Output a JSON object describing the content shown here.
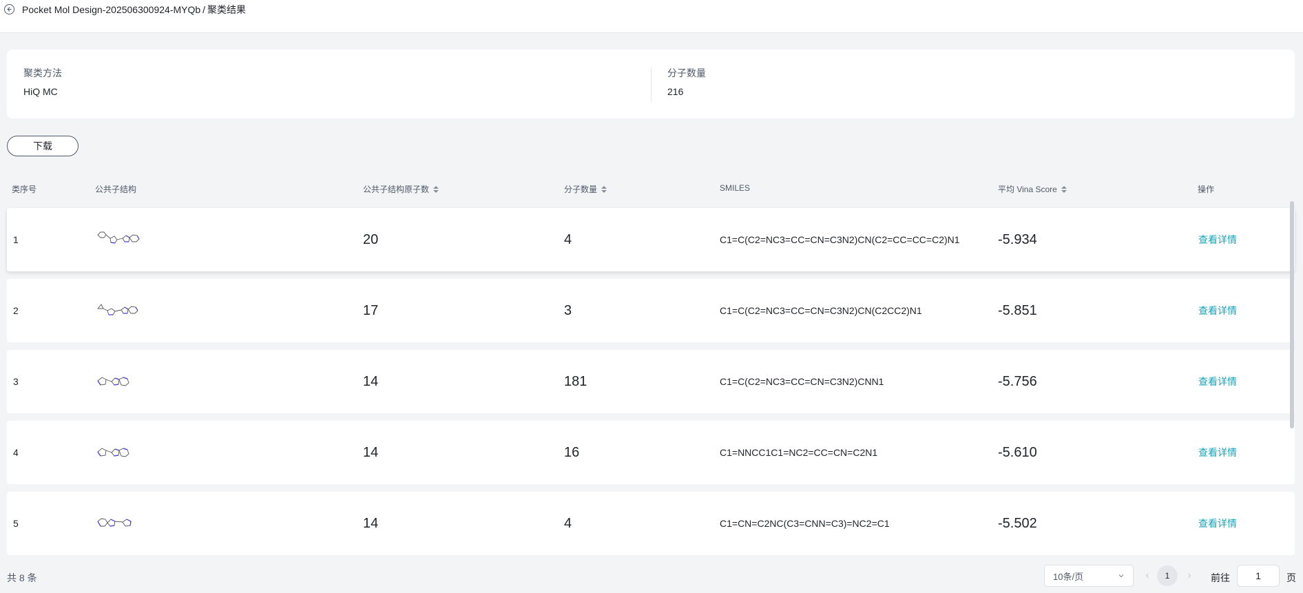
{
  "header": {
    "project": "Pocket Mol Design-202506300924-MYQb",
    "separator": "/",
    "page": "聚类结果"
  },
  "summary": {
    "method_label": "聚类方法",
    "method_value": "HiQ MC",
    "count_label": "分子数量",
    "count_value": "216"
  },
  "toolbar": {
    "download_label": "下载"
  },
  "table": {
    "columns": {
      "index": "类序号",
      "structure": "公共子结构",
      "atoms": "公共子结构原子数",
      "count": "分子数量",
      "smiles": "SMILES",
      "score": "平均 Vina Score",
      "action": "操作"
    },
    "rows": [
      {
        "index": "1",
        "atoms": "20",
        "count": "4",
        "smiles": "C1=C(C2=NC3=CC=CN=C3N2)CN(C2=CC=CC=C2)N1",
        "score": "-5.934",
        "action": "查看详情",
        "structure_icon": "phenyl-pyrazoline-imidazopyridine-structure-icon"
      },
      {
        "index": "2",
        "atoms": "17",
        "count": "3",
        "smiles": "C1=C(C2=NC3=CC=CN=C3N2)CN(C2CC2)N1",
        "score": "-5.851",
        "action": "查看详情",
        "structure_icon": "cyclopropyl-pyrazoline-imidazopyridine-structure-icon"
      },
      {
        "index": "3",
        "atoms": "14",
        "count": "181",
        "smiles": "C1=C(C2=NC3=CC=CN=C3N2)CNN1",
        "score": "-5.756",
        "action": "查看详情",
        "structure_icon": "pyrazoline-imidazopyridine-structure-icon"
      },
      {
        "index": "4",
        "atoms": "14",
        "count": "16",
        "smiles": "C1=NNCC1C1=NC2=CC=CN=C2N1",
        "score": "-5.610",
        "action": "查看详情",
        "structure_icon": "pyrazoline-imidazopyridine-structure-icon"
      },
      {
        "index": "5",
        "atoms": "14",
        "count": "4",
        "smiles": "C1=CN=C2NC(C3=CNN=C3)=NC2=C1",
        "score": "-5.502",
        "action": "查看详情",
        "structure_icon": "pyrazole-imidazopyridine-structure-icon"
      }
    ]
  },
  "footer": {
    "total": "共 8 条",
    "page_size": "10条/页",
    "current_page": "1",
    "goto_label": "前往",
    "goto_value": "1",
    "goto_unit": "页"
  },
  "colors": {
    "accent": "#1aa3b8",
    "background": "#f3f4f6",
    "molecule_carbon": "#555555",
    "molecule_nitrogen": "#3b3bdb"
  }
}
